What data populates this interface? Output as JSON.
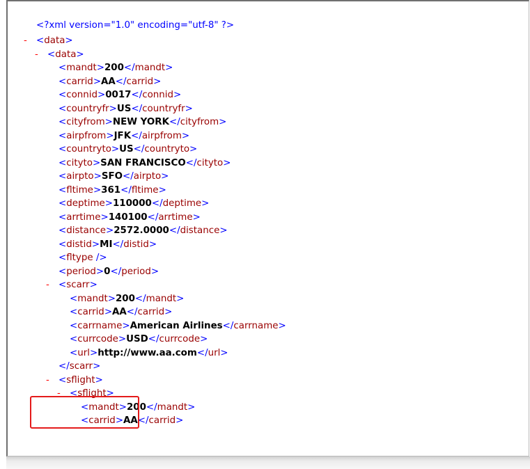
{
  "declaration": "<?xml version=\"1.0\" encoding=\"utf-8\" ?>",
  "collapse_symbol": "-",
  "nodes": [
    {
      "indent": 0,
      "collapsible": true,
      "open": "data"
    },
    {
      "indent": 1,
      "collapsible": true,
      "open": "data"
    },
    {
      "indent": 2,
      "tag": "mandt",
      "value": "200"
    },
    {
      "indent": 2,
      "tag": "carrid",
      "value": "AA"
    },
    {
      "indent": 2,
      "tag": "connid",
      "value": "0017"
    },
    {
      "indent": 2,
      "tag": "countryfr",
      "value": "US"
    },
    {
      "indent": 2,
      "tag": "cityfrom",
      "value": "NEW YORK"
    },
    {
      "indent": 2,
      "tag": "airpfrom",
      "value": "JFK"
    },
    {
      "indent": 2,
      "tag": "countryto",
      "value": "US"
    },
    {
      "indent": 2,
      "tag": "cityto",
      "value": "SAN FRANCISCO"
    },
    {
      "indent": 2,
      "tag": "airpto",
      "value": "SFO"
    },
    {
      "indent": 2,
      "tag": "fltime",
      "value": "361"
    },
    {
      "indent": 2,
      "tag": "deptime",
      "value": "110000"
    },
    {
      "indent": 2,
      "tag": "arrtime",
      "value": "140100"
    },
    {
      "indent": 2,
      "tag": "distance",
      "value": "2572.0000"
    },
    {
      "indent": 2,
      "tag": "distid",
      "value": "MI"
    },
    {
      "indent": 2,
      "empty": "fltype"
    },
    {
      "indent": 2,
      "tag": "period",
      "value": "0"
    },
    {
      "indent": 2,
      "collapsible": true,
      "open": "scarr"
    },
    {
      "indent": 3,
      "tag": "mandt",
      "value": "200"
    },
    {
      "indent": 3,
      "tag": "carrid",
      "value": "AA"
    },
    {
      "indent": 3,
      "tag": "carrname",
      "value": "American Airlines"
    },
    {
      "indent": 3,
      "tag": "currcode",
      "value": "USD"
    },
    {
      "indent": 3,
      "tag": "url",
      "value": "http://www.aa.com"
    },
    {
      "indent": 2,
      "close": "scarr"
    },
    {
      "indent": 2,
      "collapsible": true,
      "open": "sflight"
    },
    {
      "indent": 3,
      "collapsible": true,
      "open": "sflight"
    },
    {
      "indent": 4,
      "tag": "mandt",
      "value": "200"
    },
    {
      "indent": 4,
      "tag": "carrid",
      "value": "AA"
    }
  ],
  "highlight_color": "#e41b1b"
}
